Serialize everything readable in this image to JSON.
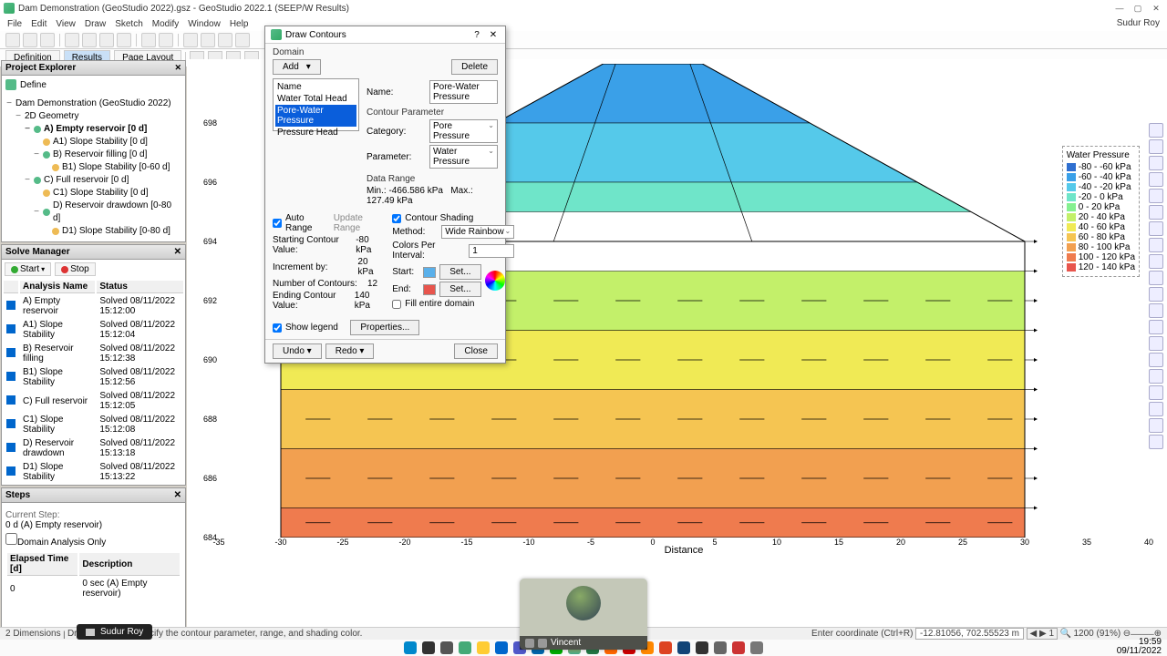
{
  "window": {
    "title": "Dam Demonstration (GeoStudio 2022).gsz - GeoStudio 2022.1 (SEEP/W Results)",
    "user": "Sudur Roy",
    "min_label": "—",
    "max_label": "▢",
    "close_label": "✕"
  },
  "menu": [
    "File",
    "Edit",
    "View",
    "Draw",
    "Sketch",
    "Modify",
    "Window",
    "Help"
  ],
  "ribbon": {
    "definition": "Definition",
    "results": "Results",
    "page_layout": "Page Layout"
  },
  "project_explorer": {
    "title": "Project Explorer",
    "define": "Define",
    "root": "Dam Demonstration (GeoStudio 2022)",
    "geometry": "2D Geometry",
    "a": "A) Empty reservoir [0 d]",
    "a1": "A1) Slope Stability [0 d]",
    "b": "B) Reservoir filling [0 d]",
    "b1": "B1) Slope Stability [0-60 d]",
    "c": "C) Full reservoir [0 d]",
    "c1": "C1) Slope Stability [0 d]",
    "d": "D) Reservoir drawdown [0-80 d]",
    "d1": "D1) Slope Stability [0-80 d]"
  },
  "solve_manager": {
    "title": "Solve Manager",
    "start": "Start",
    "stop": "Stop",
    "cols": {
      "name": "Analysis Name",
      "status": "Status"
    },
    "rows": [
      {
        "n": "A) Empty reservoir",
        "s": "Solved 08/11/2022 15:12:00"
      },
      {
        "n": "A1) Slope Stability",
        "s": "Solved 08/11/2022 15:12:04"
      },
      {
        "n": "B) Reservoir filling",
        "s": "Solved 08/11/2022 15:12:38"
      },
      {
        "n": "B1) Slope Stability",
        "s": "Solved 08/11/2022 15:12:56"
      },
      {
        "n": "C) Full reservoir",
        "s": "Solved 08/11/2022 15:12:05"
      },
      {
        "n": "C1) Slope Stability",
        "s": "Solved 08/11/2022 15:12:08"
      },
      {
        "n": "D) Reservoir drawdown",
        "s": "Solved 08/11/2022 15:13:18"
      },
      {
        "n": "D1) Slope Stability",
        "s": "Solved 08/11/2022 15:13:22"
      }
    ]
  },
  "steps": {
    "title": "Steps",
    "current_step": "Current Step:",
    "current_val": "0 d (A) Empty reservoir)",
    "domain_only": "Domain Analysis Only",
    "cols": {
      "time": "Elapsed Time [d]",
      "desc": "Description"
    },
    "row": {
      "t": "0",
      "d": "0 sec (A) Empty reservoir)"
    }
  },
  "dialog": {
    "title": "Draw Contours",
    "help": "?",
    "close": "✕",
    "domain": "Domain",
    "add": "Add",
    "delete": "Delete",
    "items": [
      "Name",
      "Water Total Head",
      "Pore-Water Pressure",
      "Pressure Head"
    ],
    "sel_idx": 2,
    "name_label": "Name:",
    "name_value": "Pore-Water Pressure",
    "param_section": "Contour Parameter",
    "category_label": "Category:",
    "category_value": "Pore Pressure",
    "parameter_label": "Parameter:",
    "parameter_value": "Water Pressure",
    "range_section": "Data Range",
    "min_label": "Min.:",
    "min_value": "-466.586 kPa",
    "max_label": "Max.:",
    "max_value": "127.49 kPa",
    "auto_range": "Auto Range",
    "update_range": "Update Range",
    "contour_shading": "Contour Shading",
    "start_contour": "Starting Contour Value:",
    "start_val": "-80 kPa",
    "increment": "Increment by:",
    "increment_val": "20 kPa",
    "num_contours": "Number of Contours:",
    "num_val": "12",
    "end_contour": "Ending Contour Value:",
    "end_val": "140 kPa",
    "method_label": "Method:",
    "method_value": "Wide Rainbow",
    "cpint_label": "Colors Per Interval:",
    "cpint_value": "1",
    "start_color": "Start:",
    "end_color": "End:",
    "set": "Set...",
    "fill_domain": "Fill entire domain",
    "show_legend": "Show legend",
    "properties": "Properties...",
    "undo": "Undo",
    "redo": "Redo",
    "close_btn": "Close"
  },
  "legend": {
    "title": "Water Pressure",
    "entries": [
      {
        "c": "#2f6fd0",
        "t": "-80 - -60 kPa"
      },
      {
        "c": "#3aa0e8",
        "t": "-60 - -40 kPa"
      },
      {
        "c": "#55c9ea",
        "t": "-40 - -20 kPa"
      },
      {
        "c": "#6fe5c9",
        "t": "-20 - 0 kPa"
      },
      {
        "c": "#85f090",
        "t": "0 - 20 kPa"
      },
      {
        "c": "#c3f06a",
        "t": "20 - 40 kPa"
      },
      {
        "c": "#f0ea55",
        "t": "40 - 60 kPa"
      },
      {
        "c": "#f5c552",
        "t": "60 - 80 kPa"
      },
      {
        "c": "#f2a050",
        "t": "80 - 100 kPa"
      },
      {
        "c": "#ef7b4e",
        "t": "100 - 120 kPa"
      },
      {
        "c": "#e8554d",
        "t": "120 - 140 kPa"
      }
    ]
  },
  "chart_data": {
    "type": "area",
    "xlabel": "Distance",
    "ylabel": "",
    "x_ticks": [
      -35,
      -30,
      -25,
      -20,
      -15,
      -10,
      -5,
      0,
      5,
      10,
      15,
      20,
      25,
      30,
      35,
      40
    ],
    "y_ticks": [
      684,
      686,
      688,
      690,
      692,
      694,
      696,
      698
    ],
    "xlim": [
      -35,
      40
    ],
    "ylim": [
      684,
      700
    ],
    "dam_crest_x": [
      -4,
      4
    ],
    "dam_base_x": [
      -30,
      30
    ],
    "dam_crest_y": 700,
    "ground_y": 694,
    "bottom_y": 684,
    "contour_bands": [
      {
        "y_top": 700,
        "y_bot": 698,
        "color": "#3aa0e8"
      },
      {
        "y_top": 698,
        "y_bot": 696,
        "color": "#55c9ea"
      },
      {
        "y_top": 696,
        "y_bot": 695,
        "color": "#6fe5c9"
      },
      {
        "y_top": 695,
        "y_bot": 693,
        "color": "#85f090"
      },
      {
        "y_top": 693,
        "y_bot": 691,
        "color": "#c3f06a"
      },
      {
        "y_top": 691,
        "y_bot": 689,
        "color": "#f0ea55"
      },
      {
        "y_top": 689,
        "y_bot": 687,
        "color": "#f5c552"
      },
      {
        "y_top": 687,
        "y_bot": 685,
        "color": "#f2a050"
      },
      {
        "y_top": 685,
        "y_bot": 684,
        "color": "#ef7b4e"
      }
    ]
  },
  "status": {
    "mode": "2 Dimensions",
    "hint": "Draw Contours: Specify the contour parameter, range, and shading color.",
    "coord_label": "Enter coordinate (Ctrl+R)",
    "coord": "-12.81056, 702.55523 m",
    "step": "1",
    "zoom": "1200 (91%)"
  },
  "participants": {
    "presenter": "Sudur Roy",
    "other": "Vincent"
  },
  "clock": {
    "time": "19:59",
    "date": "09/11/2022"
  }
}
